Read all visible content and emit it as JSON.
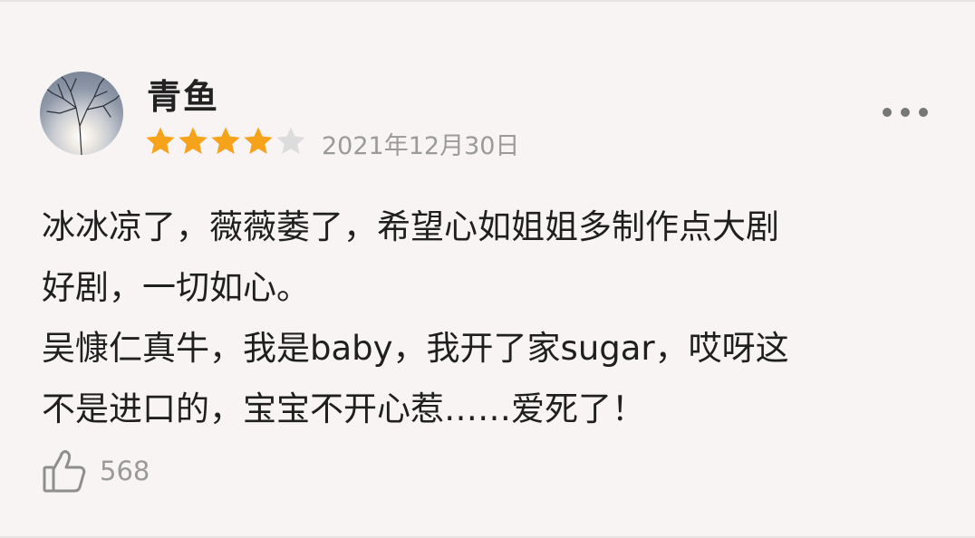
{
  "review": {
    "username": "青鱼",
    "rating": 4,
    "max_rating": 5,
    "date": "2021年12月30日",
    "content_lines": [
      "冰冰凉了，薇薇萎了，希望心如姐姐多制作点大剧",
      "好剧，一切如心。",
      "吴慷仁真牛，我是baby，我开了家sugar，哎呀这",
      "不是进口的，宝宝不开心惹……爱死了！"
    ],
    "likes": "568"
  },
  "icons": {
    "more": "more-dots-icon",
    "like": "thumbs-up-icon",
    "star": "star-icon"
  },
  "colors": {
    "star_filled": "#f7a21b",
    "star_empty": "#dcdcdc",
    "meta_text": "#9a9a9a"
  }
}
